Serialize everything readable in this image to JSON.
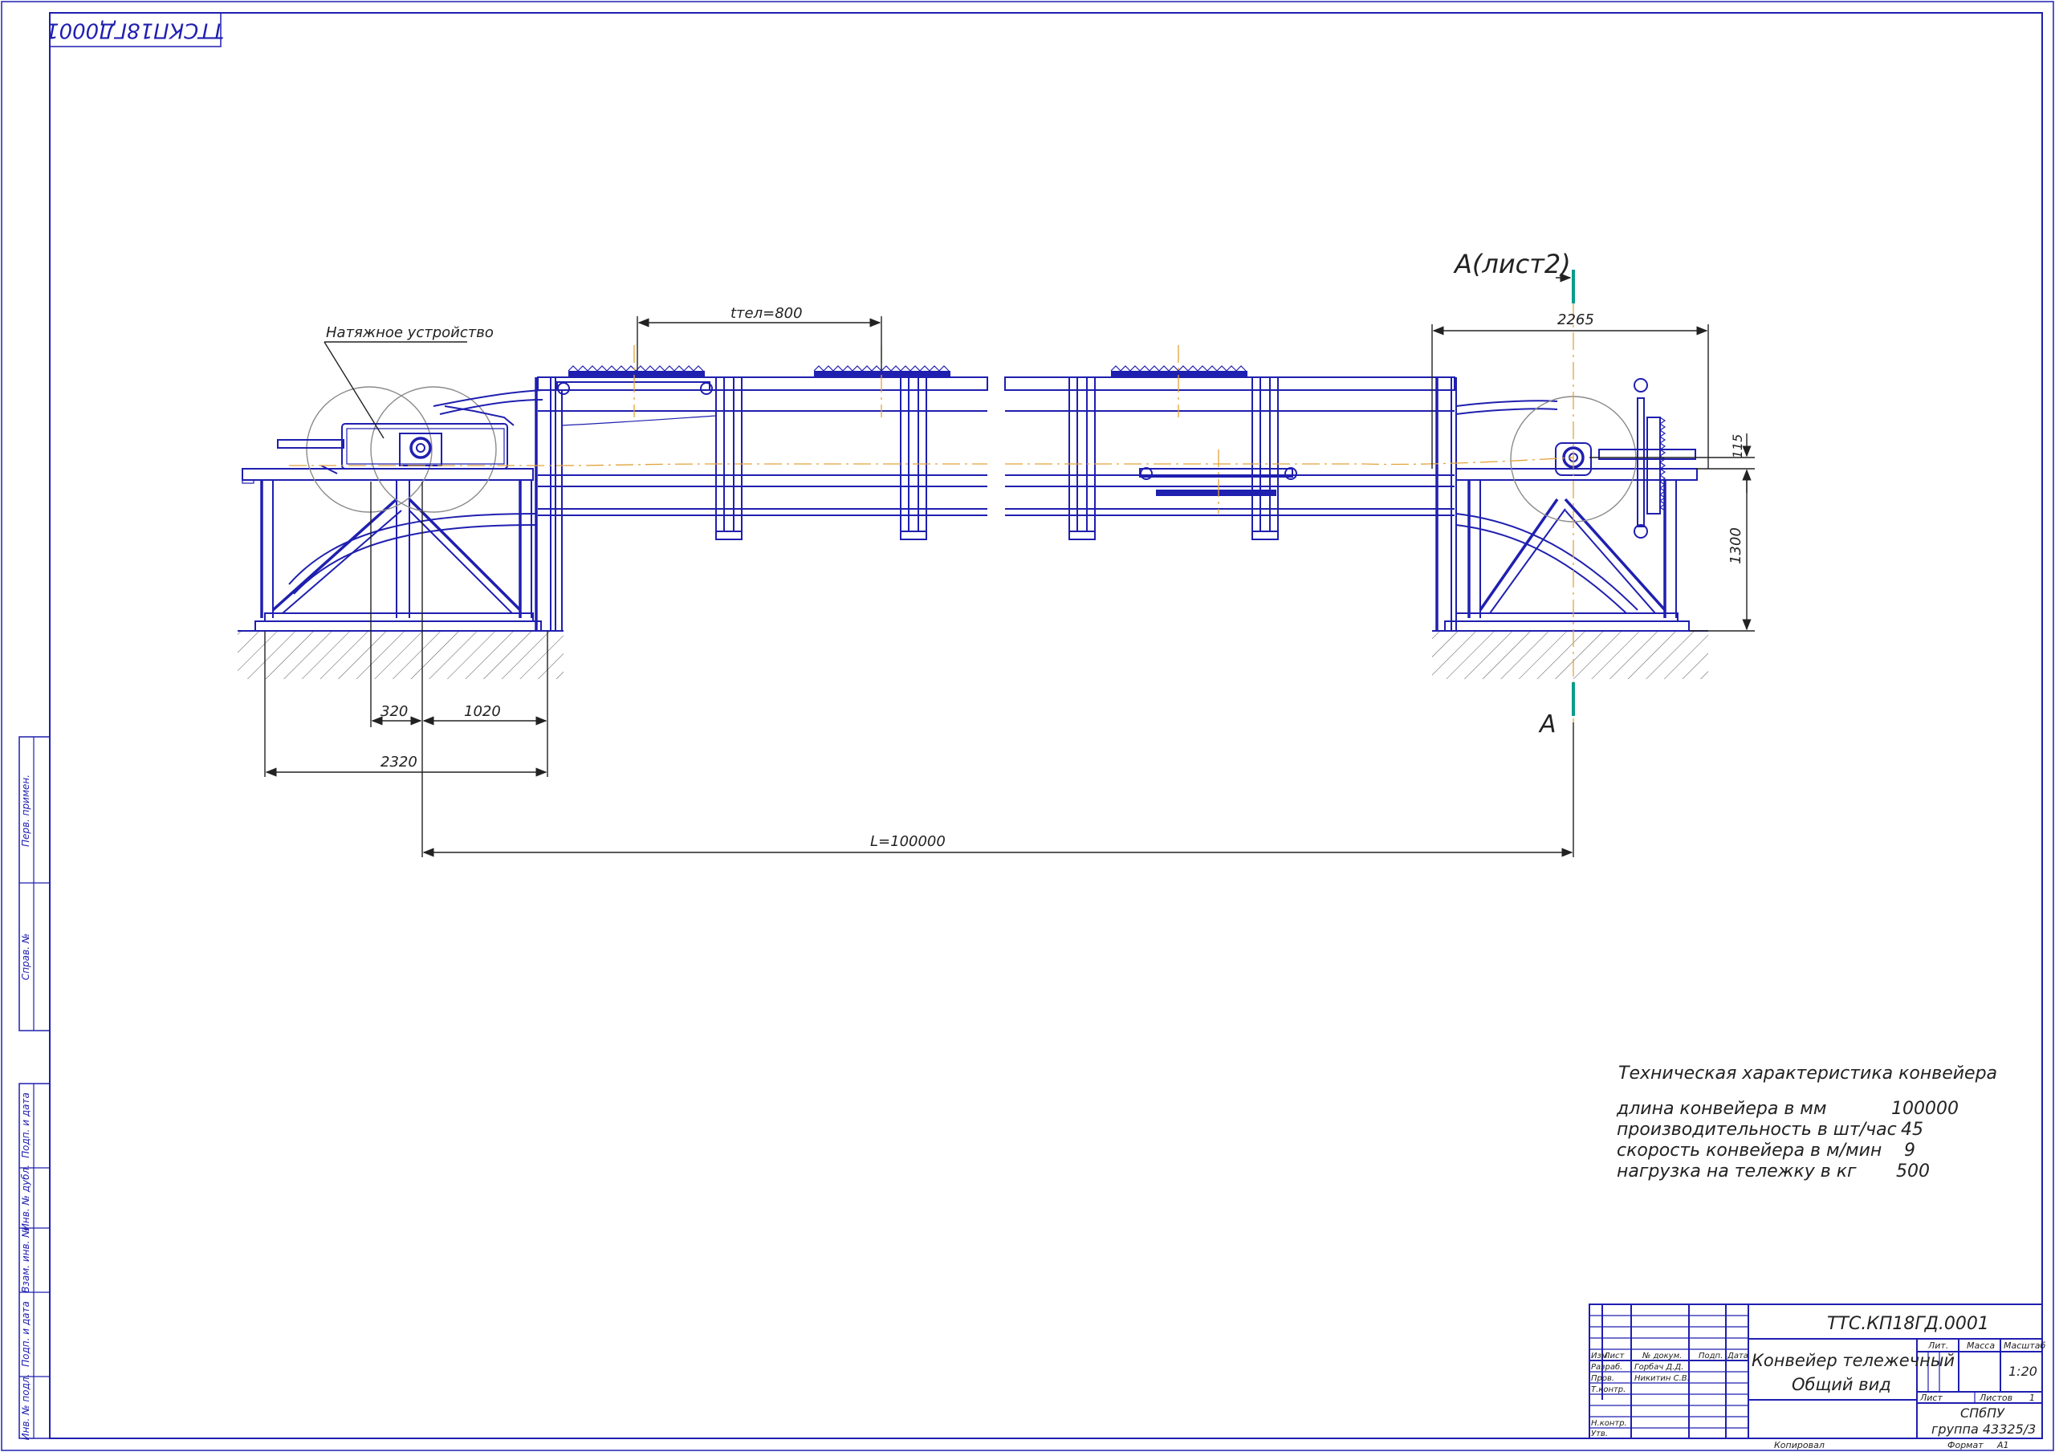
{
  "corner_stamp": "ТТСКП18ГД0001",
  "view_label_top": "А(лист2)",
  "view_label_bottom": "А",
  "leader_label": "Натяжное устройство",
  "dimensions": {
    "t_tel": "tтел=800",
    "d2265": "2265",
    "d115": "115",
    "d1300": "1300",
    "d320": "320",
    "d1020": "1020",
    "d2320": "2320",
    "length": "L=100000"
  },
  "specs": {
    "title": "Техническая характеристика конвейера",
    "rows": [
      {
        "label": "длина конвейера в мм",
        "value": "100000"
      },
      {
        "label": "производительность в шт/час",
        "value": "45"
      },
      {
        "label": "скорость конвейера в м/мин",
        "value": "9"
      },
      {
        "label": "нагрузка на тележку в кг",
        "value": "500"
      }
    ]
  },
  "side_stamp": [
    "Перв. примен.",
    "Справ. №",
    "Подп. и дата",
    "Инв. № дубл.",
    "Взам. инв. №",
    "Подп. и дата",
    "Инв. № подл."
  ],
  "title_block": {
    "designation": "ТТС.КП18ГД.0001",
    "name_line1": "Конвейер тележечный",
    "name_line2": "Общий вид",
    "col_headers": [
      "Изм",
      "Лист",
      "№ докум.",
      "Подп.",
      "Дата"
    ],
    "roles": [
      "Разраб.",
      "Пров.",
      "Т.контр.",
      "Н.контр.",
      "Утв."
    ],
    "people": [
      "Горбач Д.Д.",
      "Никитин С.В."
    ],
    "lit": "Лит.",
    "mass": "Масса",
    "scale_label": "Масштаб",
    "scale": "1:20",
    "sheet_label": "Лист",
    "sheets_label": "Листов",
    "sheets_value": "1",
    "org": "СПбПУ",
    "group": "группа 43325/3",
    "copied": "Копировал",
    "format_label": "Формат",
    "format_value": "А1"
  }
}
